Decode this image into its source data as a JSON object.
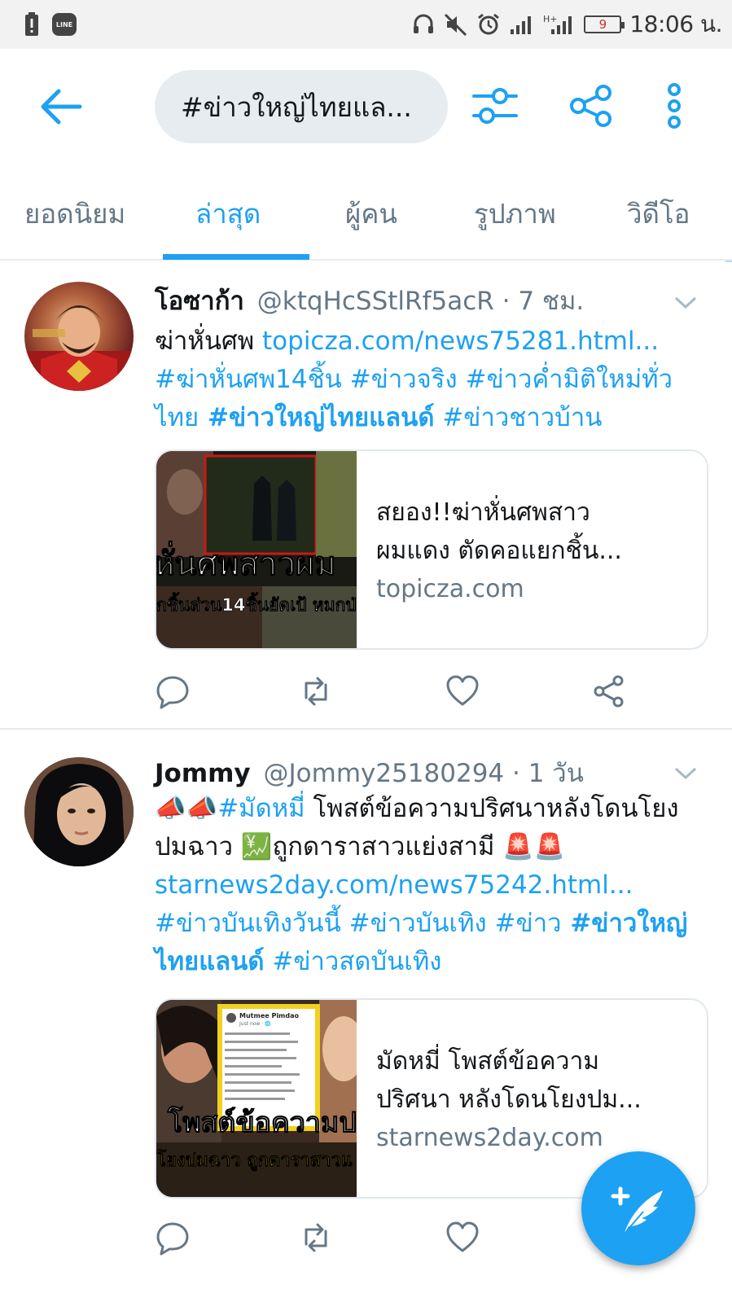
{
  "status_bar": {
    "time": "18:06 น.",
    "battery_level": "9",
    "line_app_label": "LINE"
  },
  "header": {
    "search_query": "#ข่าวใหญ่ไทยแล...",
    "icons": [
      "back-arrow-icon",
      "filter-sliders-icon",
      "share-icon",
      "more-vertical-icon"
    ]
  },
  "tabs": [
    {
      "label": "ยอดนิยม",
      "active": false
    },
    {
      "label": "ล่าสุด",
      "active": true
    },
    {
      "label": "ผู้คน",
      "active": false
    },
    {
      "label": "รูปภาพ",
      "active": false
    },
    {
      "label": "วิดีโอ",
      "active": false
    }
  ],
  "tweets": [
    {
      "name": "โอซาก้า",
      "handle": "@ktqHcSStlRf5acR",
      "time": " · 7 ชม.",
      "text_lead": "ฆ่าหั่นศพ ",
      "link": "topicza.com/news75281.html...",
      "tag1": "#ฆ่าหั่นศพ14ชิ้น",
      "tag2": " #ข่าวจริง",
      "tag3": " #ข่าวค่ำมิติใหม่ทั่วไทย",
      "tag_bold": " #ข่าวใหญ่ไทยแลนด์",
      "tag4": " #ข่าวชาวบ้าน",
      "card": {
        "title_line1": "สยอง!!ฆ่าหั่นศพสาว",
        "title_line2": "ผมแดง ตัดคอแยกชิ้น...",
        "domain": "topicza.com",
        "img_caption1": "หั่นศพสาวผม",
        "img_caption2": "กชิ้นส่วน14ชิ้นยัดเป้ หมกป่"
      }
    },
    {
      "name": "Jommy",
      "handle": "@Jommy25180294",
      "time": " · 1 วัน",
      "emoji_lead": "📣📣",
      "tag1": "#มัดหมี่",
      "text_a": " โพสต์ข้อความปริศนาหลังโดนโยงปมฉาว ",
      "emoji_mid": "💹",
      "text_b": "ถูกดาราสาวแย่งสามี ",
      "emoji_end": "🚨🚨",
      "link": "starnews2day.com/news75242.html...",
      "tag2": "#ข่าวบันเทิงวันนี้",
      "tag3": " #ข่าวบันเทิง",
      "tag4": " #ข่าว",
      "tag_bold": " #ข่าวใหญ่ไทยแลนด์",
      "tag5": " #ข่าวสดบันเทิง",
      "card": {
        "title_line1": "มัดหมี่ โพสต์ข้อความ",
        "title_line2": "ปริศนา หลังโดนโยงปม...",
        "domain": "starnews2day.com",
        "img_caption1": "ี่ โพสต์ข้อความป",
        "img_caption2": "โยงปมฉาว ถูกดาราสาวแ",
        "img_post_name": "Mutmee Pimdao",
        "img_post_time": "Just now · 🌐"
      }
    }
  ],
  "colors": {
    "accent": "#1da1f2",
    "secondary_text": "#657786",
    "divider": "#e6ecf0"
  }
}
